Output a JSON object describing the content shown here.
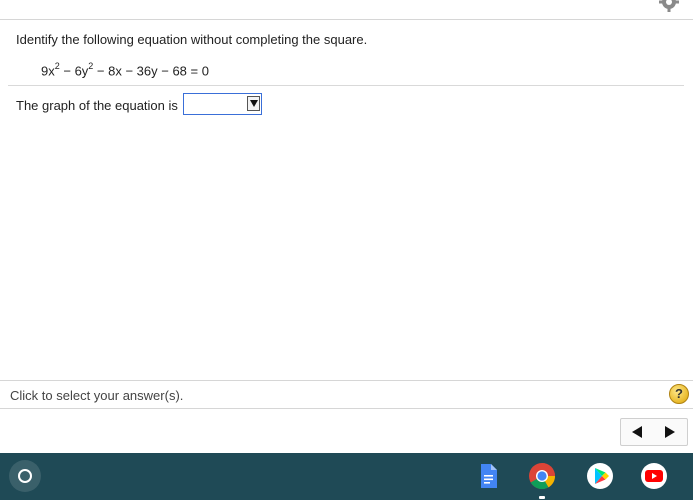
{
  "question": {
    "prompt": "Identify the following equation without completing the square.",
    "equation": {
      "t1": "9x",
      "e1": "2",
      "t2": " − 6y",
      "e2": "2",
      "t3": " − 8x − 36y − 68 = 0"
    },
    "answer_label": "The graph of the equation is",
    "answer_selected": ""
  },
  "footer": {
    "hint": "Click to select your answer(s).",
    "help_label": "?"
  },
  "icons": {
    "settings": "gear-icon",
    "help": "question-icon",
    "prev": "triangle-left-icon",
    "next": "triangle-right-icon",
    "launcher": "launcher-circle-icon",
    "shelf": [
      "google-docs-icon",
      "chrome-icon",
      "play-store-icon",
      "youtube-icon"
    ]
  },
  "colors": {
    "select_border": "#3a6fd8",
    "help_button": "#e8b92a",
    "taskbar": "#1f4a56"
  }
}
